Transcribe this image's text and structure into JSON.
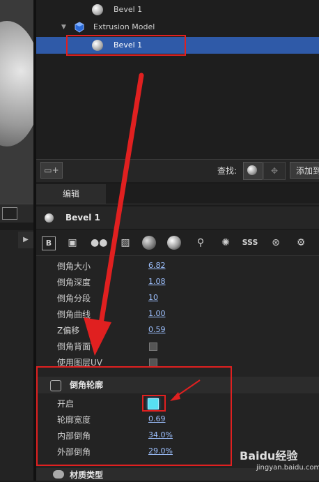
{
  "tree": {
    "items": [
      {
        "label": "Bevel 1",
        "level": 2,
        "selected": false
      },
      {
        "label": "Extrusion Model",
        "level": 1,
        "selected": false
      },
      {
        "label": "Bevel 1",
        "level": 2,
        "selected": true
      }
    ],
    "expand_glyph": "▼"
  },
  "toolbar_bottom": {
    "folder_icon": "folder-add-icon",
    "search_label": "查找:",
    "add_label": "添加到"
  },
  "edit": {
    "tab_label": "编辑",
    "title": "Bevel 1"
  },
  "props": [
    {
      "label": "倒角大小",
      "value": "6.82"
    },
    {
      "label": "倒角深度",
      "value": "1.08"
    },
    {
      "label": "倒角分段",
      "value": "10"
    },
    {
      "label": "倒角曲线",
      "value": "1.00"
    },
    {
      "label": "Z偏移",
      "value": "0.59"
    },
    {
      "label": "倒角背面",
      "value": null
    },
    {
      "label": "使用图层UV",
      "value": null
    }
  ],
  "section": {
    "title": "倒角轮廓",
    "items": [
      {
        "label": "开启",
        "checked": true
      },
      {
        "label": "轮廓宽度",
        "value": "0.69"
      },
      {
        "label": "内部倒角",
        "value": "34.0%"
      },
      {
        "label": "外部倒角",
        "value": "29.0%"
      }
    ]
  },
  "material_section": {
    "title": "材质类型"
  },
  "watermark": {
    "text": "Baidu经验",
    "url": "jingyan.baidu.com"
  },
  "colors": {
    "selection": "#2f5aa8",
    "annotation_red": "#e02020",
    "value_link": "#9ec1ff",
    "checkbox_on": "#57e0f2"
  }
}
